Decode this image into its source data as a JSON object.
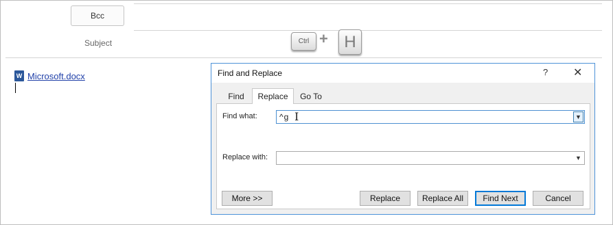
{
  "email": {
    "bcc_label": "Bcc",
    "subject_label": "Subject"
  },
  "shortcut": {
    "key1": "Ctrl",
    "plus": "+",
    "key2": "H"
  },
  "attachment": {
    "icon_letter": "W",
    "filename": "Microsoft.docx"
  },
  "dialog": {
    "title": "Find and Replace",
    "help": "?",
    "close": "✕",
    "tabs": [
      {
        "label": "Find"
      },
      {
        "label": "Replace",
        "active": true
      },
      {
        "label": "Go To"
      }
    ],
    "find_label": "Find what:",
    "find_value": "^g",
    "replace_label": "Replace with:",
    "replace_value": "",
    "dropdown_arrow": "chevron-down-icon",
    "buttons": {
      "more": "More >>",
      "replace": "Replace",
      "replace_all": "Replace All",
      "find_next": "Find Next",
      "cancel": "Cancel"
    },
    "accent_color": "#0078d7"
  }
}
